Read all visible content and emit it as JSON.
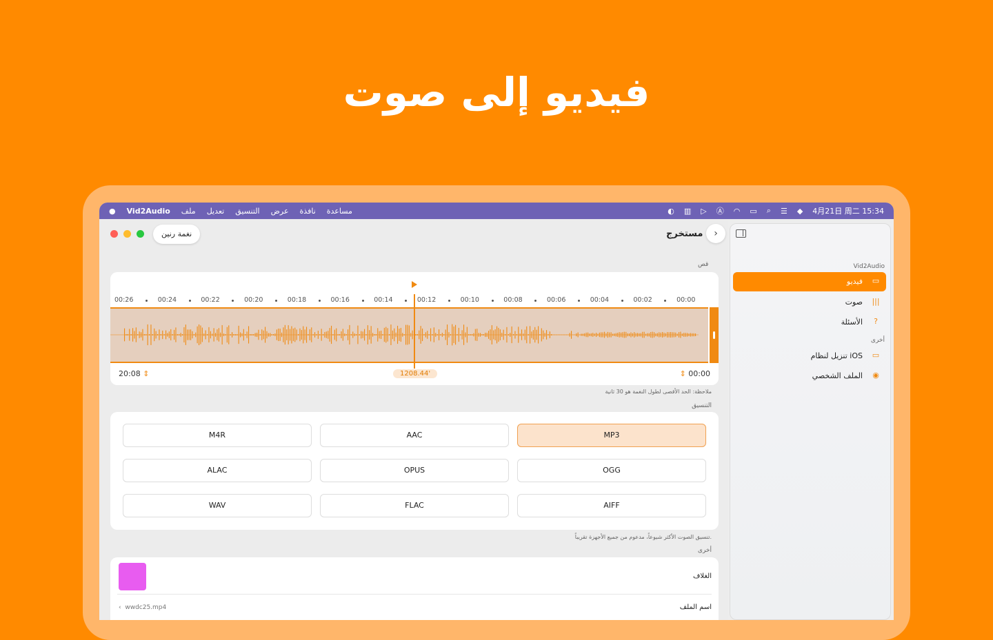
{
  "headline": "فيديو إلى صوت",
  "menubar": {
    "apple_icon": "apple-icon",
    "app_name": "Vid2Audio",
    "menus": [
      "ملف",
      "تعديل",
      "التنسيق",
      "عرض",
      "نافذة",
      "مساعدة"
    ],
    "clock": "4月21日 周二  15:34"
  },
  "toolbar": {
    "ringtone_button": "نغمة رنين",
    "title": "مستخرج"
  },
  "trim": {
    "section_label": "قص",
    "timeline_ticks": [
      "00:26",
      "00:24",
      "00:22",
      "00:20",
      "00:18",
      "00:16",
      "00:14",
      "00:12",
      "00:10",
      "00:08",
      "00:06",
      "00:04",
      "00:02",
      "00:00"
    ],
    "end_time": "20:08",
    "start_time": "00:00",
    "current_time": "1208.44'",
    "note": "ملاحظة: الحد الأقصى لطول النغمة هو 30 ثانية"
  },
  "format": {
    "section_label": "التنسيق",
    "options": [
      "M4R",
      "AAC",
      "MP3",
      "ALAC",
      "OPUS",
      "OGG",
      "WAV",
      "FLAC",
      "AIFF"
    ],
    "selected": "MP3",
    "description": "تنسيق الصوت الأكثر شيوعاً، مدعوم من جميع الأجهزة تقريباً."
  },
  "other": {
    "section_label": "أخرى",
    "cover_label": "الغلاف",
    "cover_color": "#E85CF0",
    "filename_label": "اسم الملف",
    "filename_value": "wwdc25.mp4"
  },
  "sidebar": {
    "app_section": "Vid2Audio",
    "items": [
      {
        "label": "فيديو",
        "icon": "video-icon",
        "active": true
      },
      {
        "label": "صوت",
        "icon": "waveform-icon",
        "active": false
      },
      {
        "label": "الأسئلة",
        "icon": "question-icon",
        "active": false
      }
    ],
    "other_section": "أخرى",
    "other_items": [
      {
        "label": "تنزيل لنظام iOS",
        "icon": "devices-icon"
      },
      {
        "label": "الملف الشخصي",
        "icon": "person-icon"
      }
    ]
  },
  "colors": {
    "background": "#FF8A00",
    "accent": "#F08A12",
    "menubar": "#6E62B5"
  }
}
